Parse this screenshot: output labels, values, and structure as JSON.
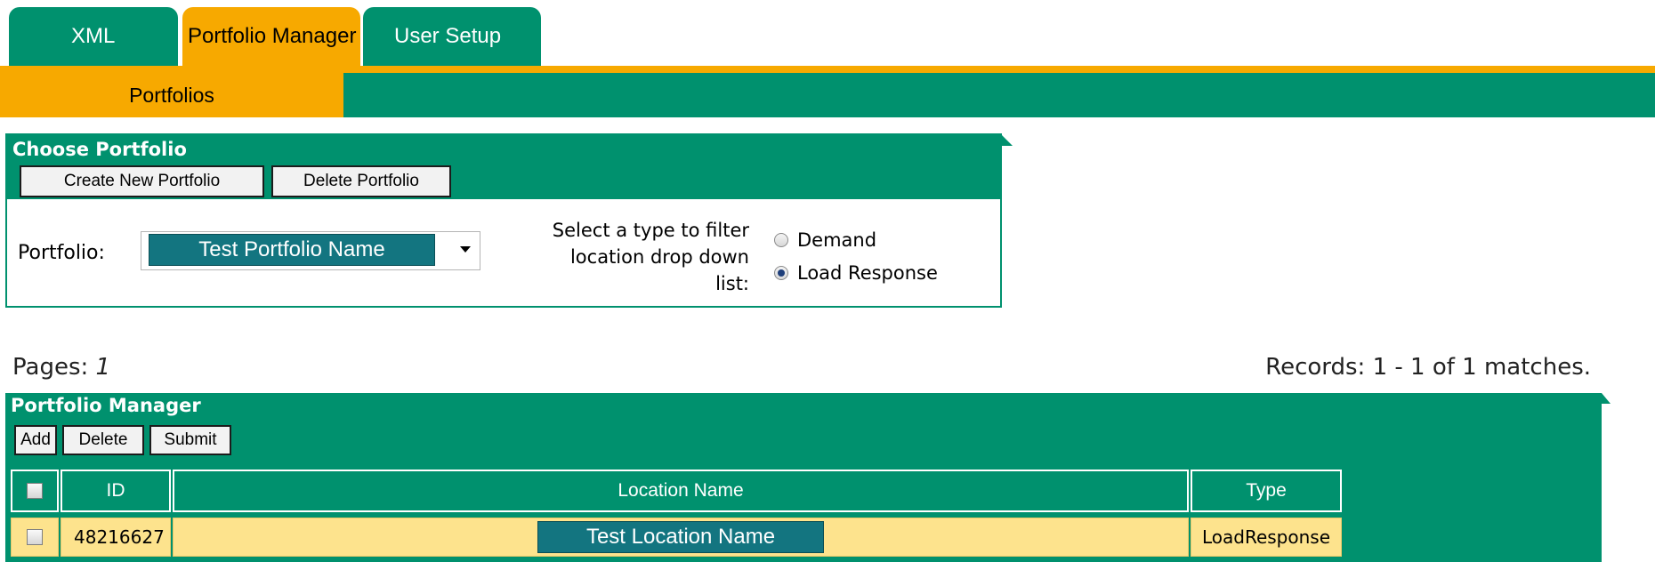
{
  "tabs": {
    "items": [
      {
        "label": "XML"
      },
      {
        "label": "Portfolio Manager",
        "active": true
      },
      {
        "label": "User Setup"
      }
    ],
    "subtab": "Portfolios"
  },
  "choose_portfolio": {
    "title": "Choose Portfolio",
    "create_button": "Create New Portfolio",
    "delete_button": "Delete Portfolio",
    "portfolio_label": "Portfolio:",
    "portfolio_selected": "Test Portfolio Name",
    "filter_label": "Select a type to filter location drop down list:",
    "filter_options": [
      {
        "label": "Demand",
        "checked": false
      },
      {
        "label": "Load Response",
        "checked": true
      }
    ]
  },
  "paging": {
    "pages_label": "Pages:",
    "pages_value": "1",
    "records_text": "Records: 1 - 1 of 1 matches."
  },
  "portfolio_manager": {
    "title": "Portfolio Manager",
    "add_button": "Add",
    "delete_button": "Delete",
    "submit_button": "Submit",
    "columns": [
      "ID",
      "Location Name",
      "Type"
    ],
    "rows": [
      {
        "id": "48216627",
        "location_name": "Test Location Name",
        "type": "LoadResponse",
        "checked": false
      }
    ]
  },
  "colors": {
    "teal": "#00916e",
    "orange": "#f7a900",
    "row_bg": "#fde38d",
    "masked_value": "#137580"
  }
}
